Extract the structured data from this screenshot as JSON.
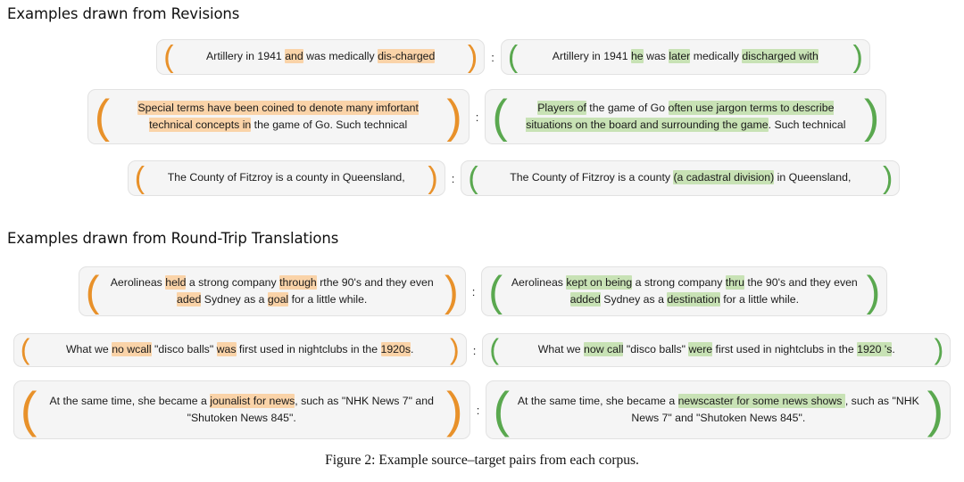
{
  "sections": [
    {
      "id": "revisions",
      "heading": "Examples drawn from Revisions"
    },
    {
      "id": "round_trip",
      "heading": "Examples drawn from Round-Trip Translations"
    }
  ],
  "separator": ":",
  "brackets": {
    "open": "(",
    "close": ")"
  },
  "colors": {
    "source_highlight": "#fad3a8",
    "target_highlight": "#c8e2b5",
    "source_bracket": "#e8912a",
    "target_bracket": "#5aa84f",
    "box_background": "#f5f5f5",
    "box_border": "#e2e2e2"
  },
  "examples": {
    "revisions": [
      {
        "source_plain": "Artillery in 1941 and was medically dis-charged",
        "target_plain": "Artillery in 1941 he was later medically discharged with",
        "source_parts": [
          {
            "t": "Artillery in 1941 ",
            "h": false
          },
          {
            "t": "and",
            "h": true
          },
          {
            "t": " was medically ",
            "h": false
          },
          {
            "t": "dis-charged",
            "h": true
          }
        ],
        "target_parts": [
          {
            "t": "Artillery in 1941 ",
            "h": false
          },
          {
            "t": "he",
            "h": true
          },
          {
            "t": " was ",
            "h": false
          },
          {
            "t": "later",
            "h": true
          },
          {
            "t": " medically ",
            "h": false
          },
          {
            "t": "discharged with",
            "h": true
          }
        ]
      },
      {
        "source_plain": "Special terms have been coined to denote many imfortant technical concepts in the game of Go. Such technical",
        "target_plain": "Players of the game of Go often use jargon terms to describe situations on the board and surrounding the game. Such technical",
        "source_parts": [
          {
            "t": "Special terms have been coined to denote many imfortant technical concepts in",
            "h": true
          },
          {
            "t": " the game of Go. Such technical",
            "h": false
          }
        ],
        "target_parts": [
          {
            "t": "Players of",
            "h": true
          },
          {
            "t": " the game of Go ",
            "h": false
          },
          {
            "t": "often use jargon terms to describe situations on the board and surrounding the game",
            "h": true
          },
          {
            "t": ". Such technical",
            "h": false
          }
        ]
      },
      {
        "source_plain": "The County of Fitzroy is a county in Queensland,",
        "target_plain": "The County of Fitzroy is a county (a cadastral division) in Queensland,",
        "source_parts": [
          {
            "t": "The County of Fitzroy is a county in Queensland,",
            "h": false
          }
        ],
        "target_parts": [
          {
            "t": "The County of Fitzroy is a county ",
            "h": false
          },
          {
            "t": "(a cadastral division)",
            "h": true
          },
          {
            "t": " in Queensland,",
            "h": false
          }
        ]
      }
    ],
    "round_trip": [
      {
        "source_plain": "Aerolineas held a strong company through rthe 90's and they even aded Sydney as a goal for a little while.",
        "target_plain": "Aerolineas kept on being a strong company thru the 90's and they even added Sydney as a destination for a little while.",
        "source_parts": [
          {
            "t": "Aerolineas ",
            "h": false
          },
          {
            "t": "held",
            "h": true
          },
          {
            "t": " a strong company ",
            "h": false
          },
          {
            "t": "through",
            "h": true
          },
          {
            "t": " rthe 90's and they even ",
            "h": false
          },
          {
            "t": "aded",
            "h": true
          },
          {
            "t": " Sydney as a ",
            "h": false
          },
          {
            "t": "goal",
            "h": true
          },
          {
            "t": " for a little while.",
            "h": false
          }
        ],
        "target_parts": [
          {
            "t": "Aerolineas ",
            "h": false
          },
          {
            "t": "kept on being",
            "h": true
          },
          {
            "t": " a strong company ",
            "h": false
          },
          {
            "t": "thru",
            "h": true
          },
          {
            "t": " the 90's and they even ",
            "h": false
          },
          {
            "t": "added",
            "h": true
          },
          {
            "t": " Sydney as a ",
            "h": false
          },
          {
            "t": "destination",
            "h": true
          },
          {
            "t": " for a little while.",
            "h": false
          }
        ]
      },
      {
        "source_plain": "What we no wcall \"disco balls\" was first used in nightclubs in the 1920s.",
        "target_plain": "What we now call \"disco balls\" were first used in nightclubs in the 1920 's.",
        "source_parts": [
          {
            "t": "What we ",
            "h": false
          },
          {
            "t": "no wcall",
            "h": true
          },
          {
            "t": " \"disco balls\" ",
            "h": false
          },
          {
            "t": "was",
            "h": true
          },
          {
            "t": " first used in nightclubs in the ",
            "h": false
          },
          {
            "t": "1920s",
            "h": true
          },
          {
            "t": ".",
            "h": false
          }
        ],
        "target_parts": [
          {
            "t": "What we ",
            "h": false
          },
          {
            "t": "now call",
            "h": true
          },
          {
            "t": " \"disco balls\" ",
            "h": false
          },
          {
            "t": "were",
            "h": true
          },
          {
            "t": " first used in nightclubs in the ",
            "h": false
          },
          {
            "t": "1920 's",
            "h": true
          },
          {
            "t": ".",
            "h": false
          }
        ]
      },
      {
        "source_plain": "At the same time, she became a jounalist for news, such as \"NHK News 7\" and \"Shutoken News 845\".",
        "target_plain": "At the same time, she became a newscaster for some news shows , such as \"NHK News 7\" and \"Shutoken News 845\".",
        "source_parts": [
          {
            "t": "At the same time, she became a ",
            "h": false
          },
          {
            "t": "jounalist for news",
            "h": true
          },
          {
            "t": ", such as \"NHK News 7\" and \"Shutoken News 845\".",
            "h": false
          }
        ],
        "target_parts": [
          {
            "t": "At the same time, she became a ",
            "h": false
          },
          {
            "t": "newscaster for some news shows ",
            "h": true
          },
          {
            "t": ", such as \"NHK News 7\" and \"Shutoken News 845\".",
            "h": false
          }
        ]
      }
    ]
  },
  "caption": "Figure 2: Example source–target pairs from each corpus."
}
